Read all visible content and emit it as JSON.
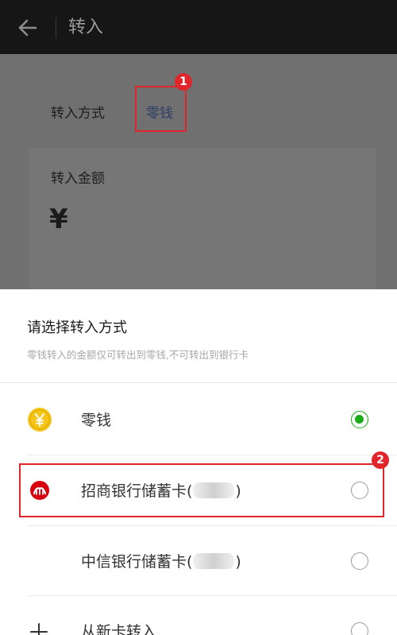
{
  "header": {
    "title": "转入",
    "back_icon": "back-arrow-icon"
  },
  "background": {
    "method_label": "转入方式",
    "method_value": "零钱",
    "amount_label": "转入金额",
    "currency_symbol": "¥"
  },
  "annotations": {
    "step_1": "1",
    "step_2": "2",
    "highlight_color": "#e0262b"
  },
  "sheet": {
    "title": "请选择转入方式",
    "subtitle": "零钱转入的金额仅可转出到零钱,不可转出到银行卡",
    "options": [
      {
        "label": "零钱",
        "icon": "wallet-coin-icon",
        "selected": true
      },
      {
        "label_prefix": "招商银行储蓄卡(",
        "label_suffix": ")",
        "icon": "cmb-bank-logo-icon",
        "selected": false
      },
      {
        "label_prefix": "中信银行储蓄卡(",
        "label_suffix": ")",
        "icon": "",
        "selected": false
      },
      {
        "label": "从新卡转入",
        "icon": "plus-icon",
        "selected": false
      }
    ]
  },
  "colors": {
    "accent_green": "#1aad19",
    "topbar": "#161616",
    "coin_yellow": "#f5c518",
    "bank_red": "#d7000f"
  }
}
